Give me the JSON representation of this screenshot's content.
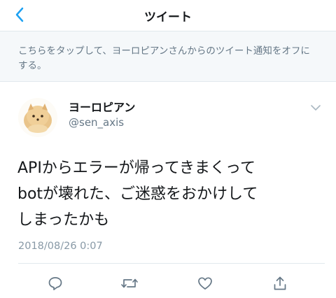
{
  "nav": {
    "title": "ツイート",
    "back_icon": "chevron-left-icon"
  },
  "notice": {
    "text": "こちらをタップして、ヨーロピアンさんからのツイート通知をオフにする。"
  },
  "tweet": {
    "author_name": "ヨーロピアン",
    "author_handle": "@sen_axis",
    "text_lines": [
      "APIからエラーが帰ってきまくって",
      "botが壊れた、ご迷惑をおかけして",
      "しまったかも"
    ],
    "timestamp": "2018/08/26 0:07"
  },
  "actions": {
    "reply_icon": "reply-icon",
    "retweet_icon": "retweet-icon",
    "like_icon": "heart-icon",
    "share_icon": "share-icon"
  },
  "colors": {
    "accent": "#1da1f2",
    "secondary_text": "#657786",
    "icon_gray": "#657786",
    "notice_bg": "#f5f8fa"
  }
}
